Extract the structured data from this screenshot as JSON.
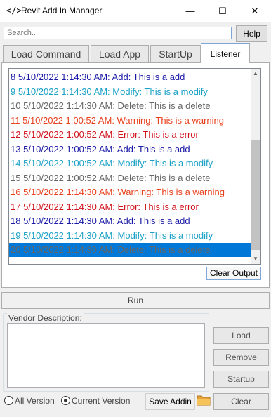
{
  "window": {
    "icon": "</>",
    "title": "Revit Add In Manager",
    "minimize_glyph": "—",
    "maximize_glyph": "☐",
    "close_glyph": "✕"
  },
  "search": {
    "placeholder": "Search..."
  },
  "help_label": "Help",
  "tabs": [
    {
      "label": "Load Command"
    },
    {
      "label": "Load App"
    },
    {
      "label": "StartUp"
    },
    {
      "label": "Listener"
    }
  ],
  "log": {
    "rows": [
      {
        "text": "8 5/10/2022 1:14:30 AM: Add: This is a add",
        "color": "#1a1aa6"
      },
      {
        "text": "9 5/10/2022 1:14:30 AM: Modify: This is a modify",
        "color": "#1ba1c5"
      },
      {
        "text": "10 5/10/2022 1:14:30 AM: Delete: This is a delete",
        "color": "#666666"
      },
      {
        "text": "11 5/10/2022 1:00:52 AM: Warning: This is a warning",
        "color": "#e8401c"
      },
      {
        "text": "12 5/10/2022 1:00:52 AM: Error: This is a error",
        "color": "#d0121b"
      },
      {
        "text": "13 5/10/2022 1:00:52 AM: Add: This is a add",
        "color": "#1a1aa6"
      },
      {
        "text": "14 5/10/2022 1:00:52 AM: Modify: This is a modify",
        "color": "#1ba1c5"
      },
      {
        "text": "15 5/10/2022 1:00:52 AM: Delete: This is a delete",
        "color": "#666666"
      },
      {
        "text": "16 5/10/2022 1:14:30 AM: Warning: This is a warning",
        "color": "#e8401c"
      },
      {
        "text": "17 5/10/2022 1:14:30 AM: Error: This is a error",
        "color": "#d0121b"
      },
      {
        "text": "18 5/10/2022 1:14:30 AM: Add: This is a add",
        "color": "#1a1aa6"
      },
      {
        "text": "19 5/10/2022 1:14:30 AM: Modify: This is a modify",
        "color": "#1ba1c5"
      },
      {
        "text": "20 5/10/2022 1:14:30 AM: Delete: This is a delete",
        "color": "#666666",
        "selected": true
      }
    ],
    "selection_color": "#0078d7"
  },
  "clear_output_label": "Clear Output",
  "run_label": "Run",
  "vendor_description_label": "Vendor Description:",
  "side_buttons": {
    "load": "Load",
    "remove": "Remove",
    "startup": "Startup",
    "clear": "Clear"
  },
  "version": {
    "all_label": "All Version",
    "current_label": "Current Version",
    "selected": "current"
  },
  "save_addin_label": "Save Addin",
  "icons": {
    "folder": "folder-icon",
    "scroll_up": "chevron-up-icon",
    "scroll_down": "chevron-down-icon"
  }
}
